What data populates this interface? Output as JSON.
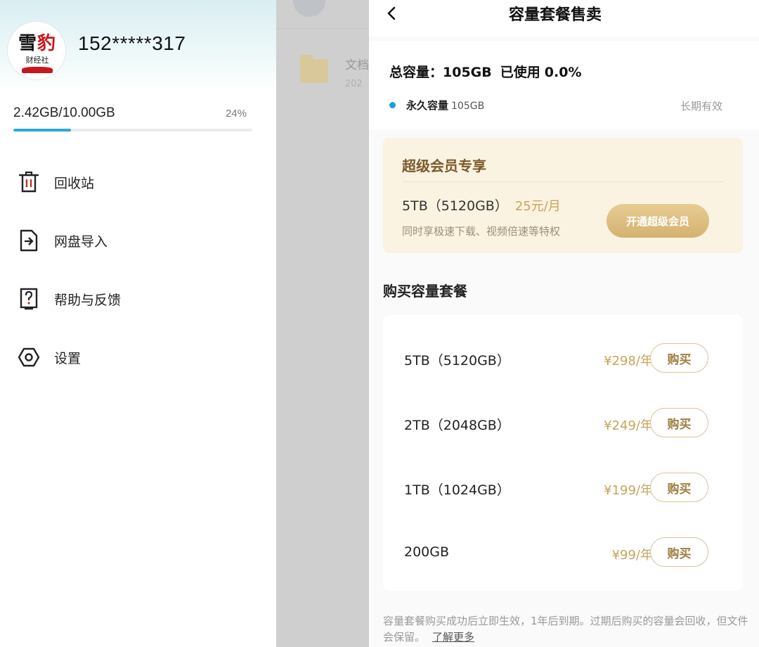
{
  "drawer": {
    "logo": {
      "text_main_a": "雪",
      "text_main_b": "豹",
      "text_sub": "财经社"
    },
    "phone": "152*****317",
    "storage": {
      "text": "2.42GB/10.00GB",
      "percent_label": "24%",
      "fill_fraction": 0.24,
      "accent": "#2aa8d8"
    },
    "menu": [
      {
        "label": "回收站",
        "icon": "trash-icon"
      },
      {
        "label": "网盘导入",
        "icon": "import-icon"
      },
      {
        "label": "帮助与反馈",
        "icon": "help-icon"
      },
      {
        "label": "设置",
        "icon": "settings-icon"
      }
    ]
  },
  "background_page": {
    "folder_title": "文档",
    "folder_date": "202"
  },
  "page": {
    "title": "容量套餐售卖",
    "summary": {
      "total_label": "总容量：",
      "total_value": "105GB",
      "used_label": "已使用",
      "used_value": "0.0%",
      "permanent_label": "永久容量",
      "permanent_size": "105GB",
      "validity": "长期有效",
      "dot_color": "#1a9fe0"
    },
    "vip": {
      "title": "超级会员专享",
      "size": "5TB（5120GB）",
      "price": "25元/月",
      "desc": "同时享极速下载、视频倍速等特权",
      "button": "开通超级会员"
    },
    "buy_heading": "购买容量套餐",
    "plans": [
      {
        "name": "5TB（5120GB）",
        "price": "¥298/年",
        "button": "购买"
      },
      {
        "name": "2TB（2048GB）",
        "price": "¥249/年",
        "button": "购买"
      },
      {
        "name": "1TB（1024GB）",
        "price": "¥199/年",
        "button": "购买"
      },
      {
        "name": "200GB",
        "price": "¥99/年",
        "button": "购买"
      }
    ],
    "footnote": "容量套餐购买成功后立即生效，1年后到期。过期后购买的容量会回收，但文件会保留。",
    "learn_more": "了解更多",
    "accent_gold": "#c9a35c"
  }
}
